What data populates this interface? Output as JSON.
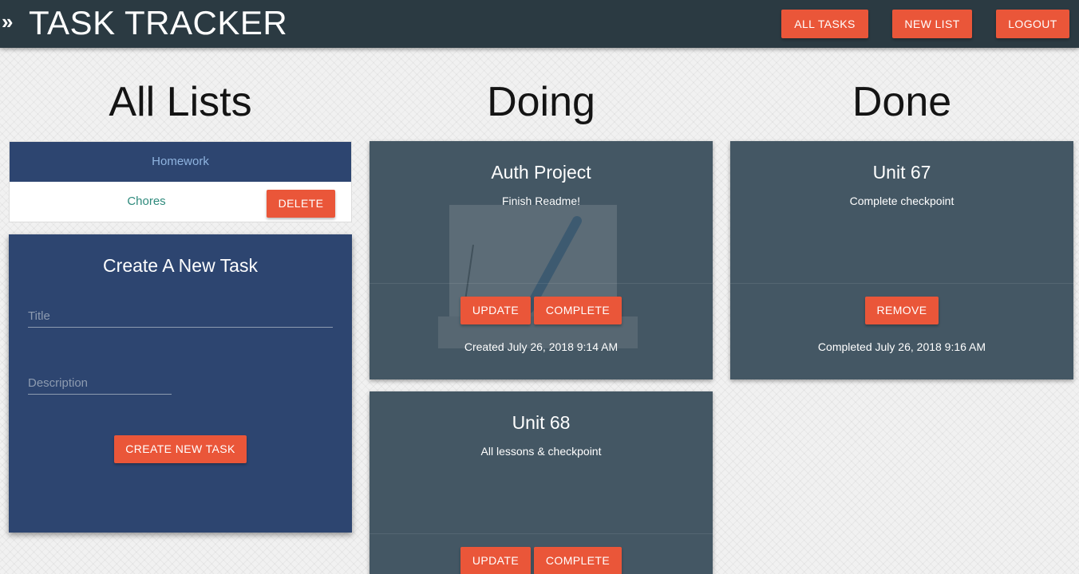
{
  "header": {
    "brand": "TASK TRACKER",
    "nav": {
      "all_tasks": "ALL TASKS",
      "new_list": "NEW LIST",
      "logout": "LOGOUT"
    }
  },
  "columns": {
    "all_lists": "All Lists",
    "doing": "Doing",
    "done": "Done"
  },
  "lists": [
    {
      "name": "Homework",
      "selected": true
    },
    {
      "name": "Chores",
      "delete_label": "DELETE"
    }
  ],
  "create_form": {
    "title": "Create A New Task",
    "title_placeholder": "Title",
    "description_placeholder": "Description",
    "submit_label": "CREATE NEW TASK"
  },
  "doing": [
    {
      "title": "Auth Project",
      "description": "Finish Readme!",
      "update_label": "UPDATE",
      "complete_label": "COMPLETE",
      "meta": "Created July 26, 2018 9:14 AM"
    },
    {
      "title": "Unit 68",
      "description": "All lessons & checkpoint",
      "update_label": "UPDATE",
      "complete_label": "COMPLETE"
    }
  ],
  "done": [
    {
      "title": "Unit 67",
      "description": "Complete checkpoint",
      "remove_label": "REMOVE",
      "meta": "Completed July 26, 2018 9:16 AM"
    }
  ],
  "colors": {
    "navbar": "#2b3a42",
    "accent": "#ea5639",
    "list_panel": "#2d4570",
    "task_card": "#445764",
    "list_link": "#2e8a7c"
  }
}
